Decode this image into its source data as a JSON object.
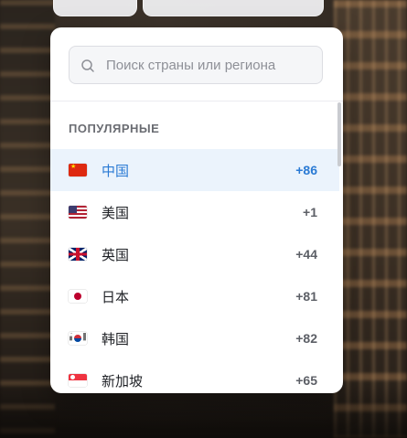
{
  "search": {
    "placeholder": "Поиск страны или региона",
    "value": ""
  },
  "list": {
    "section_title": "ПОПУЛЯРНЫЕ",
    "items": [
      {
        "name": "中国",
        "code": "+86",
        "flag": "flag-cn",
        "selected": true
      },
      {
        "name": "美国",
        "code": "+1",
        "flag": "flag-us",
        "selected": false
      },
      {
        "name": "英国",
        "code": "+44",
        "flag": "flag-gb",
        "selected": false
      },
      {
        "name": "日本",
        "code": "+81",
        "flag": "flag-jp",
        "selected": false
      },
      {
        "name": "韩国",
        "code": "+82",
        "flag": "flag-kr",
        "selected": false
      },
      {
        "name": "新加坡",
        "code": "+65",
        "flag": "flag-sg",
        "selected": false
      }
    ]
  },
  "colors": {
    "selected_text": "#2a7ad4",
    "selected_bg": "#ebf3fc"
  }
}
